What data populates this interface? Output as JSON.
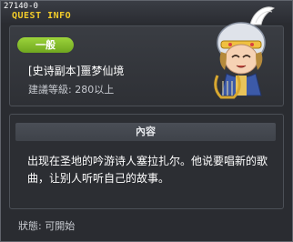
{
  "window": {
    "quest_id": "27140-0",
    "title": "QUEST INFO"
  },
  "quest": {
    "category_badge": "一般",
    "name": "[史诗副本]噩梦仙境",
    "required_level": "建議等級: 280以上"
  },
  "content": {
    "header": "內容",
    "text": "出现在圣地的吟游诗人塞拉扎尔。他说要唱新的歌曲，让别人听听自己的故事。"
  },
  "status": {
    "text": "狀態: 可開始"
  },
  "colors": {
    "title": "#f2cc2a",
    "badge": "#8cc832",
    "background": "#2a2c31"
  },
  "icons": {
    "npc_portrait": "bard-npc-portrait"
  }
}
